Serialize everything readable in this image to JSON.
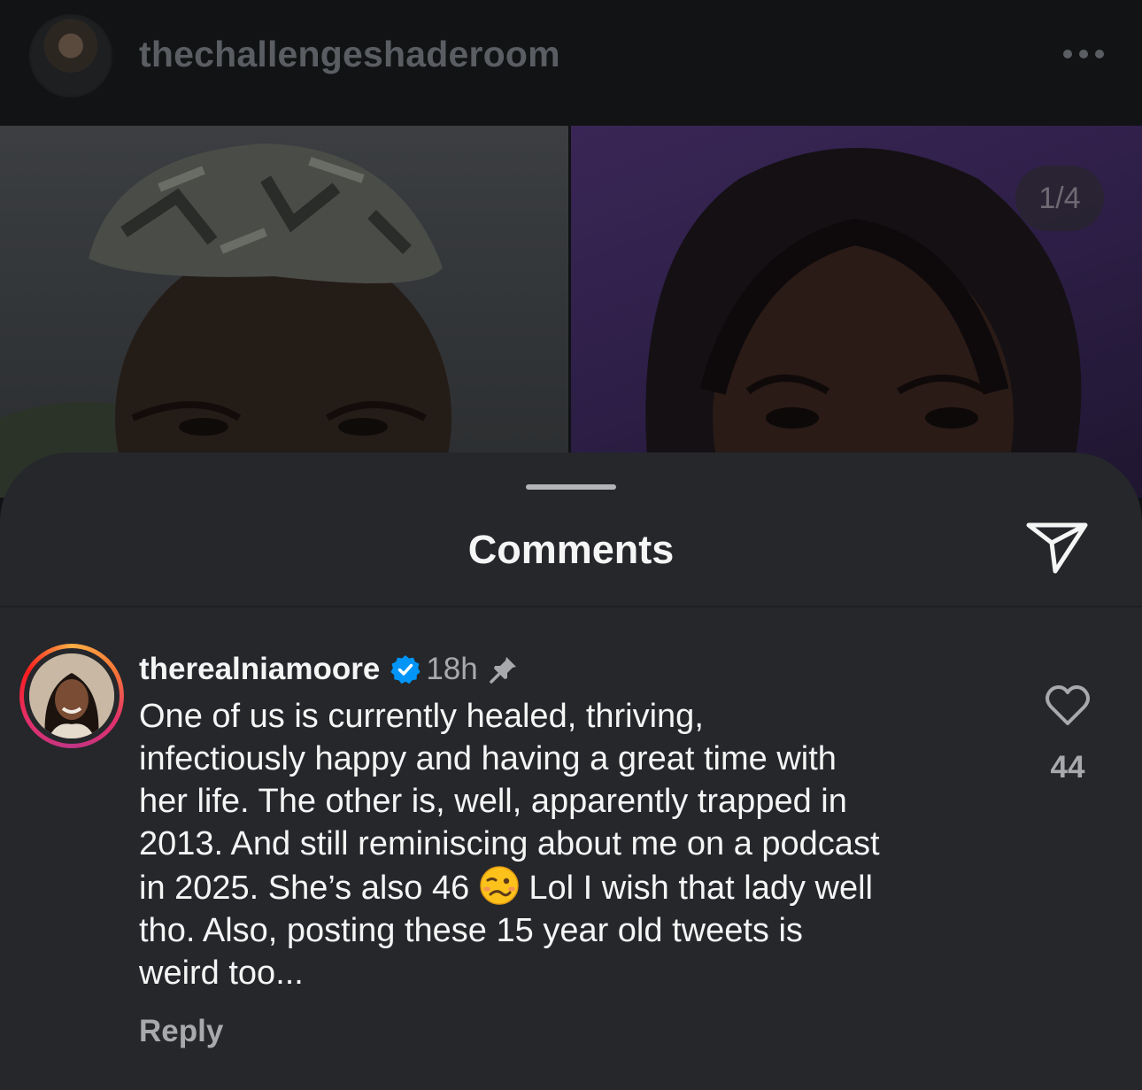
{
  "header": {
    "username": "thechallengeshaderoom",
    "more_icon": "more-horizontal-icon"
  },
  "post": {
    "photo_counter": "1/4"
  },
  "comments_sheet": {
    "title": "Comments",
    "share_icon": "send-icon"
  },
  "comment": {
    "username": "therealniamoore",
    "verified": true,
    "time": "18h",
    "pinned": true,
    "text_before_emoji": "One of us is currently healed, thriving,\ninfectiously happy and having a great time with\nher life. The other is, well, apparently trapped in\n2013. And still reminiscing about me on a podcast\nin 2025. She’s also 46 ",
    "emoji": "woozy-face",
    "text_after_emoji": " Lol I wish that lady well\ntho. Also, posting these 15 year old tweets is\nweird too...",
    "like_count": "44",
    "reply_label": "Reply"
  },
  "colors": {
    "sheet_bg": "#25272b",
    "header_bg": "#111315",
    "text_primary": "#f5f5f5",
    "text_secondary": "#a7a9ad",
    "verified_blue": "#0095f6"
  }
}
